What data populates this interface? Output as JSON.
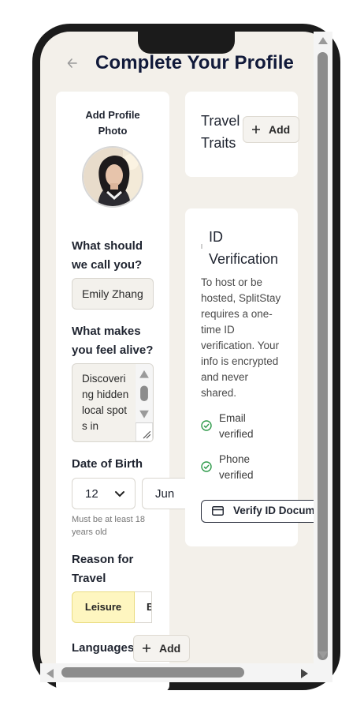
{
  "header": {
    "back_icon": "arrow-left-icon",
    "title": "Complete Your Profile"
  },
  "profile_photo": {
    "label": "Add Profile Photo"
  },
  "name": {
    "label": "What should we call you?",
    "value": "Emily Zhang"
  },
  "alive": {
    "label": "What makes you feel alive?",
    "value": "Discovering hidden local spots in"
  },
  "dob": {
    "label": "Date of Birth",
    "day": "12",
    "month": "Jun",
    "hint": "Must be at least 18 years old"
  },
  "reason": {
    "label": "Reason for Travel",
    "options": [
      "Leisure",
      "B"
    ],
    "selected": "Leisure"
  },
  "languages": {
    "label": "Languages",
    "add_label": "Add"
  },
  "traits": {
    "title": "Travel Traits",
    "add_label": "Add"
  },
  "id_verification": {
    "title": "ID Verification",
    "description": "To host or be hosted, SplitStay requires a one-time ID verification. Your info is encrypted and never shared.",
    "email_status": "Email verified",
    "phone_status": "Phone verified",
    "button_label": "Verify ID Docum",
    "check_color": "#2e9a4a"
  },
  "colors": {
    "background": "#f3f0ea",
    "title": "#111a3a",
    "selected_pill": "#fef6c0"
  }
}
